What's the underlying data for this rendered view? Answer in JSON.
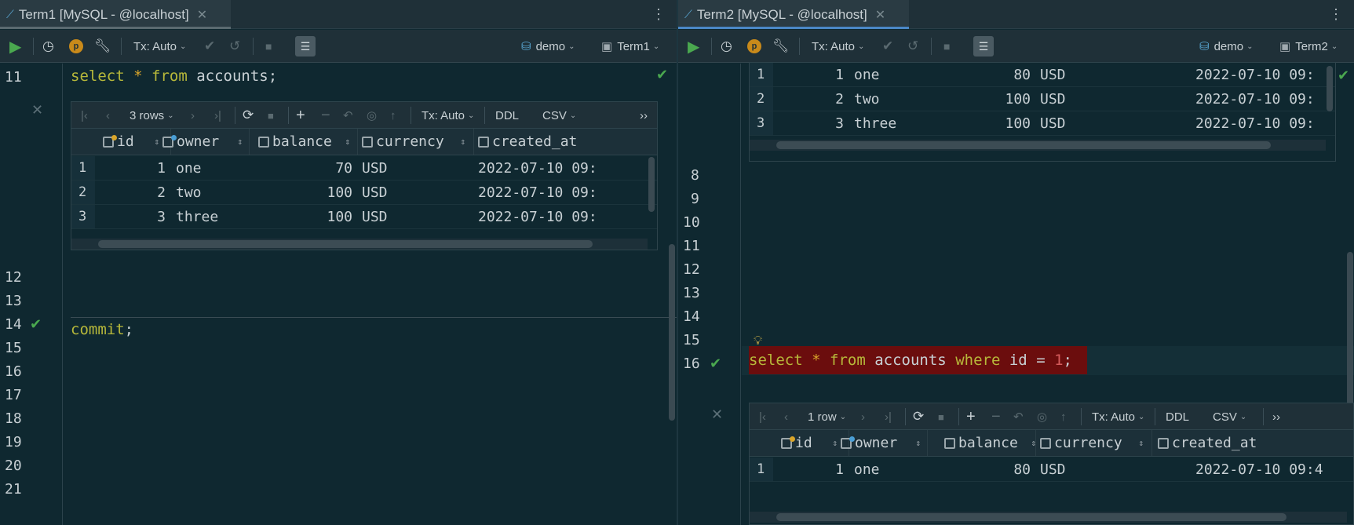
{
  "left": {
    "tab": {
      "title": "Term1 [MySQL - @localhost]"
    },
    "toolbar": {
      "tx": "Tx: Auto",
      "schema": "demo",
      "session": "Term1"
    },
    "lines": {
      "n11": "11",
      "n12": "12",
      "n13": "13",
      "n14": "14",
      "n15": "15",
      "n16": "16",
      "n17": "17",
      "n18": "18",
      "n19": "19",
      "n20": "20",
      "n21": "21"
    },
    "code": {
      "l11_kw1": "select",
      "l11_star": "*",
      "l11_kw2": "from",
      "l11_rest": "accounts;",
      "l14_kw": "commit",
      "l14_rest": ";"
    },
    "result": {
      "rows_label": "3 rows",
      "tx": "Tx: Auto",
      "ddl": "DDL",
      "csv": "CSV",
      "more": "››",
      "columns": [
        "id",
        "owner",
        "balance",
        "currency",
        "created_at"
      ],
      "rows": [
        {
          "n": "1",
          "id": "1",
          "owner": "one",
          "balance": "70",
          "currency": "USD",
          "created_at": "2022-07-10 09:"
        },
        {
          "n": "2",
          "id": "2",
          "owner": "two",
          "balance": "100",
          "currency": "USD",
          "created_at": "2022-07-10 09:"
        },
        {
          "n": "3",
          "id": "3",
          "owner": "three",
          "balance": "100",
          "currency": "USD",
          "created_at": "2022-07-10 09:"
        }
      ]
    }
  },
  "right": {
    "tab": {
      "title": "Term2 [MySQL - @localhost]"
    },
    "toolbar": {
      "tx": "Tx: Auto",
      "schema": "demo",
      "session": "Term2"
    },
    "lines": {
      "n8": "8",
      "n9": "9",
      "n10": "10",
      "n11": "11",
      "n12": "12",
      "n13": "13",
      "n14": "14",
      "n15": "15",
      "n16": "16"
    },
    "top_result": {
      "rows": [
        {
          "n": "1",
          "id": "1",
          "owner": "one",
          "balance": "80",
          "currency": "USD",
          "created_at": "2022-07-10 09:"
        },
        {
          "n": "2",
          "id": "2",
          "owner": "two",
          "balance": "100",
          "currency": "USD",
          "created_at": "2022-07-10 09:"
        },
        {
          "n": "3",
          "id": "3",
          "owner": "three",
          "balance": "100",
          "currency": "USD",
          "created_at": "2022-07-10 09:"
        }
      ]
    },
    "code": {
      "l16_kw1": "select",
      "l16_star": "*",
      "l16_kw2": "from",
      "l16_t": "accounts",
      "l16_kw3": "where",
      "l16_col": "id",
      "l16_eq": "=",
      "l16_num": "1",
      "l16_semi": ";"
    },
    "result": {
      "rows_label": "1 row",
      "tx": "Tx: Auto",
      "ddl": "DDL",
      "csv": "CSV",
      "more": "››",
      "columns": [
        "id",
        "owner",
        "balance",
        "currency",
        "created_at"
      ],
      "rows": [
        {
          "n": "1",
          "id": "1",
          "owner": "one",
          "balance": "80",
          "currency": "USD",
          "created_at": "2022-07-10 09:4"
        }
      ]
    }
  },
  "colors": {
    "accent_tab": "#4a88c7",
    "keyword": "#b7b83a",
    "run": "#4aa84f",
    "error_highlight": "#6b0d0d"
  }
}
